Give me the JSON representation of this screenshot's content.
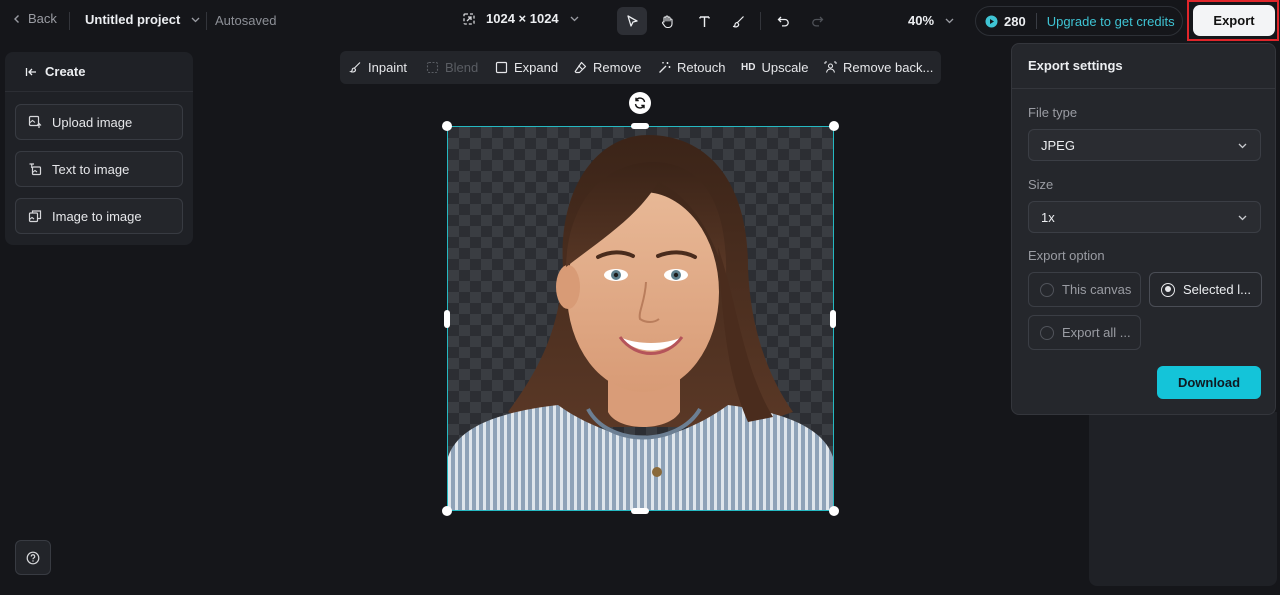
{
  "topbar": {
    "back_label": "Back",
    "project_name": "Untitled project",
    "save_status": "Autosaved",
    "canvas_size": "1024 × 1024",
    "zoom": "40%",
    "credits": "280",
    "upgrade_label": "Upgrade to get credits",
    "export_label": "Export"
  },
  "left_panel": {
    "header": "Create",
    "items": [
      {
        "label": "Upload image",
        "icon": "upload-image-icon"
      },
      {
        "label": "Text to image",
        "icon": "text-to-image-icon"
      },
      {
        "label": "Image to image",
        "icon": "image-to-image-icon"
      }
    ]
  },
  "tools": {
    "inpaint": "Inpaint",
    "blend": "Blend",
    "expand": "Expand",
    "remove": "Remove",
    "retouch": "Retouch",
    "upscale": "Upscale",
    "upscale_badge": "HD",
    "remove_background": "Remove back..."
  },
  "export_settings": {
    "title": "Export settings",
    "file_type_label": "File type",
    "file_type_value": "JPEG",
    "size_label": "Size",
    "size_value": "1x",
    "export_option_label": "Export option",
    "options": {
      "this_canvas": "This canvas",
      "selected": "Selected l...",
      "export_all": "Export all ..."
    },
    "selected_option": "selected",
    "download_label": "Download"
  },
  "colors": {
    "accent": "#14c4d9",
    "selection": "#25b9c2",
    "highlight": "#e0262b"
  }
}
